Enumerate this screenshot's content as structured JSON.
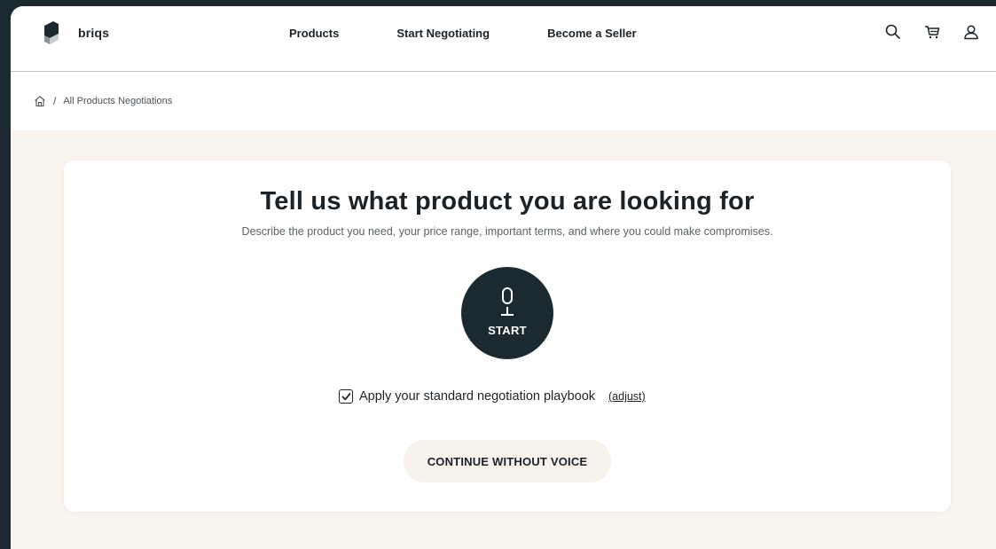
{
  "header": {
    "brand": "briqs",
    "nav": [
      "Products",
      "Start Negotiating",
      "Become a Seller"
    ],
    "icons": [
      "search-icon",
      "cart-icon",
      "user-icon"
    ]
  },
  "breadcrumb": {
    "separator": "/",
    "current": "All Products Negotiations"
  },
  "main": {
    "title": "Tell us what product you are looking for",
    "subtitle": "Describe the product you need, your price range, important terms, and where you could make compromises.",
    "mic_label": "START",
    "playbook_label": "Apply your standard negotiation playbook",
    "playbook_checked": true,
    "adjust_label": "(adjust)",
    "continue_label": "CONTINUE WITHOUT VOICE"
  },
  "colors": {
    "dark": "#1b2a30",
    "page_bg": "#faf4ef",
    "button_bg": "#f7f1ec"
  }
}
